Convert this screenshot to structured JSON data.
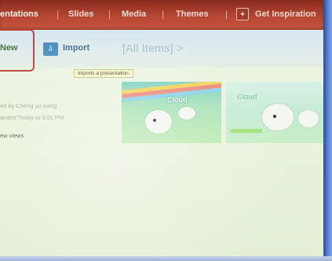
{
  "topnav": {
    "items": [
      {
        "label": "entations",
        "active": true
      },
      {
        "label": "Slides",
        "active": false
      },
      {
        "label": "Media",
        "active": false
      },
      {
        "label": "Themes",
        "active": false
      }
    ],
    "separator": "|",
    "inspiration": {
      "label": "Get Inspiration",
      "icon": "lightbulb-icon"
    }
  },
  "toolbar": {
    "new_label": "New",
    "import_label": "Import",
    "import_icon": "import-icon",
    "filter_label": "[All Items] >"
  },
  "tooltip": {
    "text": "Imports a presentation."
  },
  "presentation": {
    "created_by": "ed by Cheng yu wang",
    "modified": "anded Today at 3:01 PM",
    "views": "ew views"
  },
  "thumbnails": [
    {
      "title": "Cloud",
      "icon": "slide-thumbnail-1"
    },
    {
      "title": "Cloud",
      "icon": "slide-thumbnail-2"
    }
  ],
  "colors": {
    "nav_bar": "#b64633",
    "highlight_box": "#b9453a",
    "import_icon": "#4a8fbf",
    "tooltip_bg": "#f6f5c8"
  }
}
